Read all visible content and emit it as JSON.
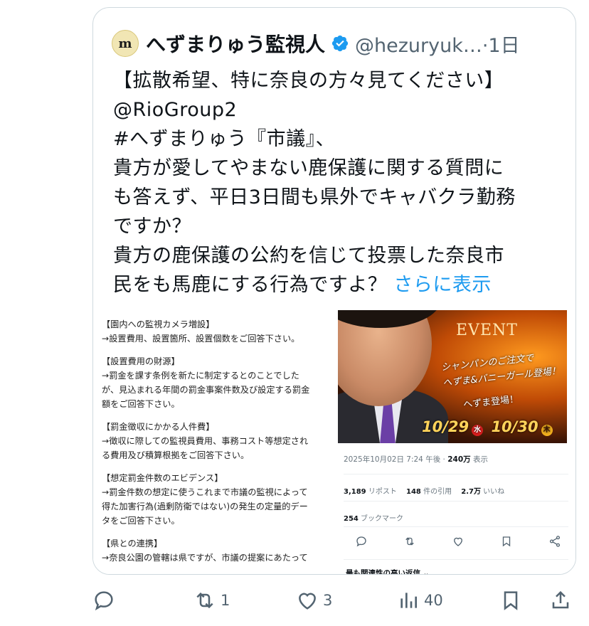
{
  "quote": {
    "avatar_text": "m",
    "display_name": "へずまりゅう監視人",
    "handle_time": "@hezuryuk…·1日",
    "text_lines": [
      "【拡散希望、特に奈良の方々見てください】",
      "@RioGroup2",
      "#へずまりゅう『市議』、",
      "貴方が愛してやまない鹿保護に関する質問に",
      "も答えず、平日3日間も県外でキャバクラ勤務",
      "ですか？",
      "貴方の鹿保護の公約を信じて投票した奈良市",
      "民をも馬鹿にする行為ですよ？ "
    ],
    "show_more": "さらに表示"
  },
  "embedded": {
    "doc_lines": [
      "【園内への監視カメラ増設】",
      "→設置費用、設置箇所、設置個数をご回答下さい。",
      "",
      "【設置費用の財源】",
      "→罰金を課す条例を新たに制定するとのことでした",
      "が、見込まれる年間の罰金事案件数及び設定する罰金",
      "額をご回答下さい。",
      "",
      "【罰金徴収にかかる人件費】",
      "→徴収に際しての監視員費用、事務コスト等想定され",
      "る費用及び積算根拠をご回答下さい。",
      "",
      "【想定罰金件数のエビデンス】",
      "→罰金件数の想定に使うこれまで市議の監視によって",
      "得た加害行為(過剰防衛ではない)の発生の定量的デー",
      "タをご回答下さい。",
      "",
      "【県との連携】",
      "→奈良公園の管轄は県ですが、市議の提案にあたって"
    ],
    "photo": {
      "event": "EVENT",
      "champagne_line1": "シャンパンのご注文で",
      "champagne_line2": "へずま&バニーガール登場！",
      "hezuma": "へずま登場！",
      "date1": "10/29",
      "dow1": "水",
      "date2": "10/30",
      "dow2": "木"
    },
    "timestamp": "2025年10月02日 7:24 午後 · ",
    "views_num": "240万",
    "views_label": " 表示",
    "reposts_num": "3,189",
    "reposts_label": " リポスト",
    "quotes_num": "148",
    "quotes_label": " 件の引用",
    "likes_num": "2.7万",
    "likes_label": " いいね",
    "bookmarks_num": "254",
    "bookmarks_label": " ブックマーク",
    "relevant_replies": "最も関連性の高い返信 ⌄"
  },
  "actions": {
    "reply_count": "",
    "repost_count": "1",
    "like_count": "3",
    "views_count": "40"
  },
  "colors": {
    "link": "#1d9bf0",
    "muted": "#536471",
    "verified": "#1d9bf0"
  }
}
